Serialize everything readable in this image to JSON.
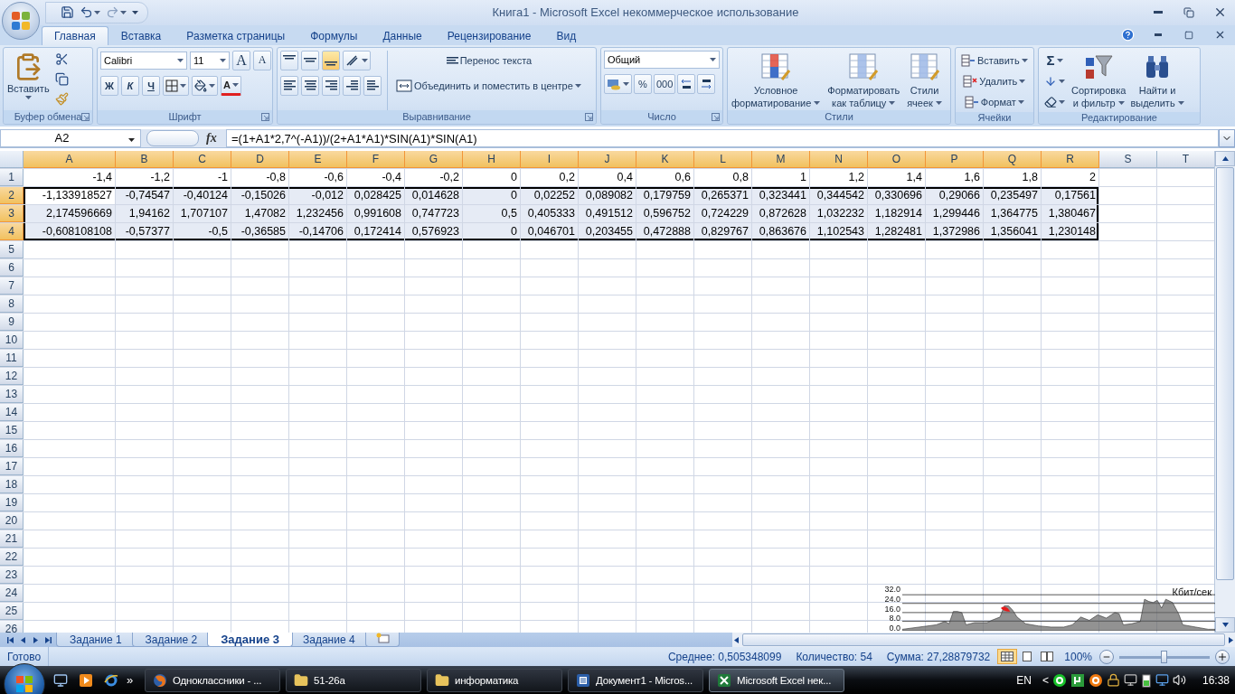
{
  "window": {
    "title": "Книга1 - Microsoft Excel некоммерческое использование"
  },
  "ribbon": {
    "tabs": [
      {
        "label": "Главная",
        "selected": true
      },
      {
        "label": "Вставка",
        "selected": false
      },
      {
        "label": "Разметка страницы",
        "selected": false
      },
      {
        "label": "Формулы",
        "selected": false
      },
      {
        "label": "Данные",
        "selected": false
      },
      {
        "label": "Рецензирование",
        "selected": false
      },
      {
        "label": "Вид",
        "selected": false
      }
    ],
    "groups": [
      {
        "kind": "clipboard",
        "label": "Буфер обмена",
        "launcher": true,
        "paste": "Вставить"
      },
      {
        "kind": "font",
        "label": "Шрифт",
        "launcher": true,
        "font": "Calibri",
        "size": "11",
        "grow": "A",
        "shrink": "A",
        "bold": "Ж",
        "italic": "К",
        "underline": "Ч",
        "color_letter": "A"
      },
      {
        "kind": "alignment",
        "label": "Выравнивание",
        "launcher": true,
        "vertical": [
          {
            "selected": false
          },
          {
            "selected": false
          },
          {
            "selected": true
          }
        ],
        "wrap": "Перенос текста",
        "merge": "Объединить и поместить в центре"
      },
      {
        "kind": "number",
        "label": "Число",
        "launcher": true,
        "format": "Общий",
        "percent": "%",
        "thousands": "000"
      },
      {
        "kind": "styles",
        "label": "Стили",
        "launcher": false,
        "buttons": [
          {
            "lines": [
              "Условное",
              "форматирование"
            ]
          },
          {
            "lines": [
              "Форматировать",
              "как таблицу"
            ]
          },
          {
            "lines": [
              "Стили",
              "ячеек"
            ]
          }
        ]
      },
      {
        "kind": "cells",
        "label": "Ячейки",
        "launcher": false,
        "buttons": [
          "Вставить",
          "Удалить",
          "Формат"
        ]
      },
      {
        "kind": "editing",
        "label": "Редактирование",
        "launcher": false,
        "sum": "Σ",
        "buttons": [
          {
            "lines": [
              "Сортировка",
              "и фильтр"
            ]
          },
          {
            "lines": [
              "Найти и",
              "выделить"
            ]
          }
        ]
      }
    ]
  },
  "formula_bar": {
    "name_box": "A2",
    "fx": "fx",
    "formula": "=(1+A1*2,7^(-A1))/(2+A1*A1)*SIN(A1)*SIN(A1)"
  },
  "sheet": {
    "columns": [
      {
        "label": "A",
        "selected": true
      },
      {
        "label": "B",
        "selected": true
      },
      {
        "label": "C",
        "selected": true
      },
      {
        "label": "D",
        "selected": true
      },
      {
        "label": "E",
        "selected": true
      },
      {
        "label": "F",
        "selected": true
      },
      {
        "label": "G",
        "selected": true
      },
      {
        "label": "H",
        "selected": true
      },
      {
        "label": "I",
        "selected": true
      },
      {
        "label": "J",
        "selected": true
      },
      {
        "label": "K",
        "selected": true
      },
      {
        "label": "L",
        "selected": true
      },
      {
        "label": "M",
        "selected": true
      },
      {
        "label": "N",
        "selected": true
      },
      {
        "label": "O",
        "selected": true
      },
      {
        "label": "P",
        "selected": true
      },
      {
        "label": "Q",
        "selected": true
      },
      {
        "label": "R",
        "selected": true
      },
      {
        "label": "S",
        "selected": false
      },
      {
        "label": "T",
        "selected": false
      }
    ],
    "rows": [
      {
        "label": "1",
        "selected": false,
        "cells": [
          "-1,4",
          "-1,2",
          "-1",
          "-0,8",
          "-0,6",
          "-0,4",
          "-0,2",
          "0",
          "0,2",
          "0,4",
          "0,6",
          "0,8",
          "1",
          "1,2",
          "1,4",
          "1,6",
          "1,8",
          "2"
        ]
      },
      {
        "label": "2",
        "selected": true,
        "cells": [
          "-1,133918527",
          "-0,74547",
          "-0,40124",
          "-0,15026",
          "-0,012",
          "0,028425",
          "0,014628",
          "0",
          "0,02252",
          "0,089082",
          "0,179759",
          "0,265371",
          "0,323441",
          "0,344542",
          "0,330696",
          "0,29066",
          "0,235497",
          "0,17561"
        ]
      },
      {
        "label": "3",
        "selected": true,
        "cells": [
          "2,174596669",
          "1,94162",
          "1,707107",
          "1,47082",
          "1,232456",
          "0,991608",
          "0,747723",
          "0,5",
          "0,405333",
          "0,491512",
          "0,596752",
          "0,724229",
          "0,872628",
          "1,032232",
          "1,182914",
          "1,299446",
          "1,364775",
          "1,380467"
        ]
      },
      {
        "label": "4",
        "selected": true,
        "cells": [
          "-0,608108108",
          "-0,57377",
          "-0,5",
          "-0,36585",
          "-0,14706",
          "0,172414",
          "0,576923",
          "0",
          "0,046701",
          "0,203455",
          "0,472888",
          "0,829767",
          "0,863676",
          "1,102543",
          "1,282481",
          "1,372986",
          "1,356041",
          "1,230148"
        ]
      },
      {
        "label": "5",
        "selected": false
      },
      {
        "label": "6",
        "selected": false
      },
      {
        "label": "7",
        "selected": false
      },
      {
        "label": "8",
        "selected": false
      },
      {
        "label": "9",
        "selected": false
      },
      {
        "label": "10",
        "selected": false
      },
      {
        "label": "11",
        "selected": false
      },
      {
        "label": "12",
        "selected": false
      },
      {
        "label": "13",
        "selected": false
      },
      {
        "label": "14",
        "selected": false
      },
      {
        "label": "15",
        "selected": false
      },
      {
        "label": "16",
        "selected": false
      },
      {
        "label": "17",
        "selected": false
      },
      {
        "label": "18",
        "selected": false
      },
      {
        "label": "19",
        "selected": false
      },
      {
        "label": "20",
        "selected": false
      },
      {
        "label": "21",
        "selected": false
      },
      {
        "label": "22",
        "selected": false
      },
      {
        "label": "23",
        "selected": false
      },
      {
        "label": "24",
        "selected": false
      },
      {
        "label": "25",
        "selected": false
      },
      {
        "label": "26",
        "selected": false
      }
    ]
  },
  "sheet_tabs": [
    {
      "label": "Задание 1",
      "selected": false
    },
    {
      "label": "Задание 2",
      "selected": false
    },
    {
      "label": "Задание 3",
      "selected": true
    },
    {
      "label": "Задание 4",
      "selected": false
    }
  ],
  "status_bar": {
    "mode": "Готово",
    "average": "Среднее: 0,505348099",
    "count": "Количество: 54",
    "sum": "Сумма: 27,28879732",
    "zoom": "100%",
    "zoom_slider": {
      "level": 0.5
    }
  },
  "traffic_meter": {
    "unit": "Кбит/сек",
    "ticks": [
      "32.0",
      "24.0",
      "16.0",
      "8.0",
      "0.0"
    ]
  },
  "taskbar": {
    "more": "»",
    "tasks": [
      {
        "label": "Одноклассники - ...",
        "kind": "browser",
        "selected": false
      },
      {
        "label": "51-26а",
        "kind": "folder",
        "selected": false
      },
      {
        "label": "информатика",
        "kind": "folder",
        "selected": false
      },
      {
        "label": "Документ1 - Micros...",
        "kind": "word",
        "selected": false
      },
      {
        "label": "Microsoft Excel нек...",
        "kind": "excel",
        "selected": true
      }
    ],
    "language": "EN",
    "tray_expand": "<",
    "clock": "16:38"
  }
}
